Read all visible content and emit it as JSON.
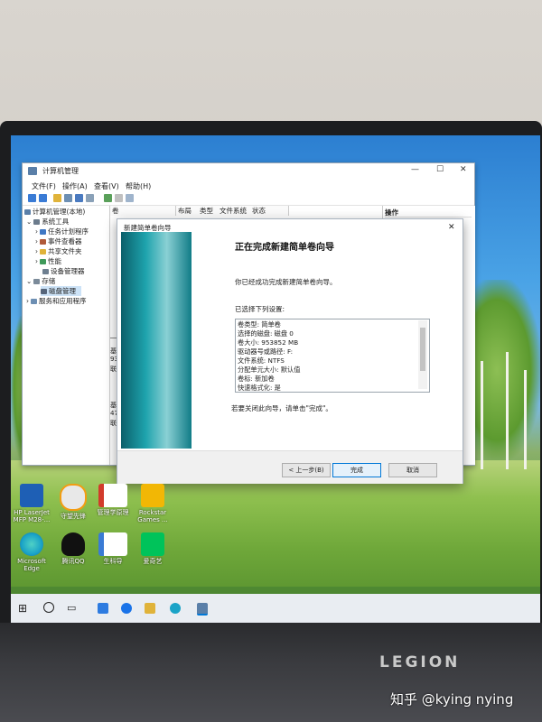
{
  "mgmt_window": {
    "title": "计算机管理",
    "controls": [
      "—",
      "☐",
      "✕"
    ],
    "menu": [
      "文件(F)",
      "操作(A)",
      "查看(V)",
      "帮助(H)"
    ],
    "tree": [
      {
        "label": "计算机管理(本地)",
        "indent": 0
      },
      {
        "label": "系统工具",
        "indent": 1
      },
      {
        "label": "任务计划程序",
        "indent": 2
      },
      {
        "label": "事件查看器",
        "indent": 2
      },
      {
        "label": "共享文件夹",
        "indent": 2
      },
      {
        "label": "性能",
        "indent": 2
      },
      {
        "label": "设备管理器",
        "indent": 2
      },
      {
        "label": "存储",
        "indent": 1
      },
      {
        "label": "磁盘管理",
        "indent": 2
      },
      {
        "label": "服务和应用程序",
        "indent": 1
      }
    ],
    "columns": [
      "卷",
      "布局",
      "类型",
      "文件系统",
      "状态"
    ],
    "actions_header": "操作",
    "mid_fragments": [
      "基",
      "93",
      "联",
      "基",
      "47",
      "联"
    ]
  },
  "wizard": {
    "title": "新建简单卷向导",
    "close": "✕",
    "heading": "正在完成新建简单卷向导",
    "description": "你已经成功完成新建简单卷向导。",
    "settings_label": "已选择下列设置:",
    "settings": [
      "卷类型: 简单卷",
      "选择的磁盘: 磁盘 0",
      "卷大小: 953852 MB",
      "驱动器号或路径: F:",
      "文件系统: NTFS",
      "分配单元大小: 默认值",
      "卷标: 新加卷",
      "快速格式化: 是"
    ],
    "finish_note": "若要关闭此向导，请单击\"完成\"。",
    "buttons": {
      "back": "< 上一步(B)",
      "finish": "完成",
      "cancel": "取消"
    }
  },
  "desktop_icons": [
    {
      "label": "HP LaserJet MFP M28-...",
      "color": "#1e5fb5"
    },
    {
      "label": "守望先锋",
      "color": "#e8e8e8"
    },
    {
      "label": "管理学原理",
      "color": "#d23b2b"
    },
    {
      "label": "Rockstar Games ...",
      "color": "#f2b705"
    },
    {
      "label": "Microsoft Edge",
      "color": "#1aa3c7"
    },
    {
      "label": "腾讯QQ",
      "color": "#111111"
    },
    {
      "label": "生科导",
      "color": "#3a7bd5"
    },
    {
      "label": "爱奇艺",
      "color": "#00c35a"
    }
  ],
  "branding": {
    "laptop": "LEGION",
    "watermark": "知乎 @kying nying"
  }
}
